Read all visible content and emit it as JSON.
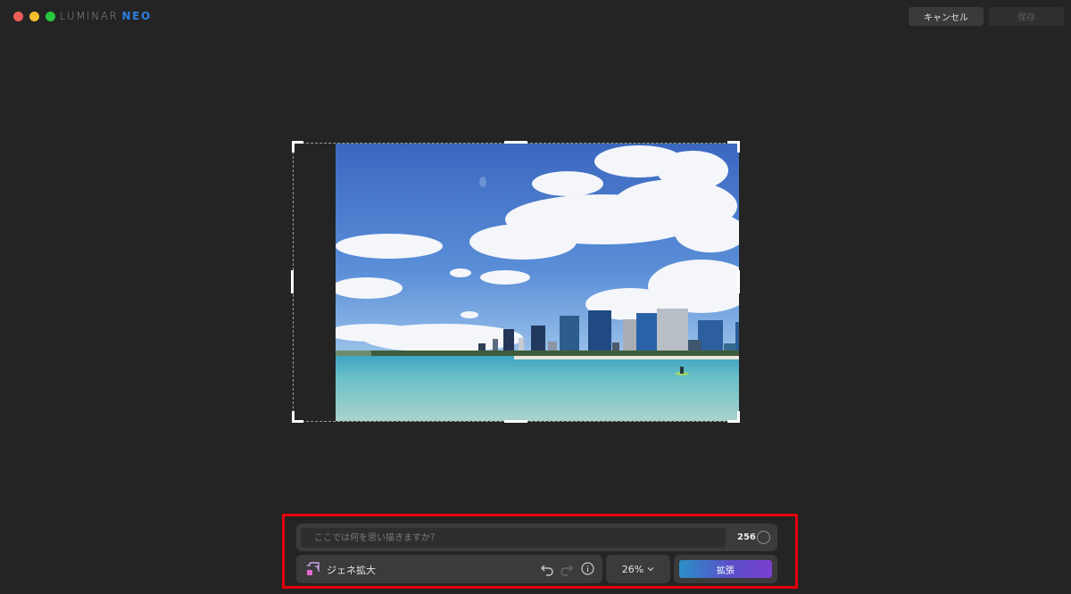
{
  "app": {
    "logo_part1": "LUMINAR",
    "logo_part2": "NEO",
    "brand_color": "#2f7fe0"
  },
  "toolbar": {
    "cancel_label": "キャンセル",
    "save_label": "保存"
  },
  "prompt": {
    "placeholder": "ここでは何を思い描きますか？",
    "value": "",
    "char_limit": "256"
  },
  "tool": {
    "name": "ジェネ拡大",
    "icon": "crop-expand-icon"
  },
  "zoom": {
    "value": "26%"
  },
  "action": {
    "expand_label": "拡張"
  },
  "highlight_color": "#e4000f"
}
